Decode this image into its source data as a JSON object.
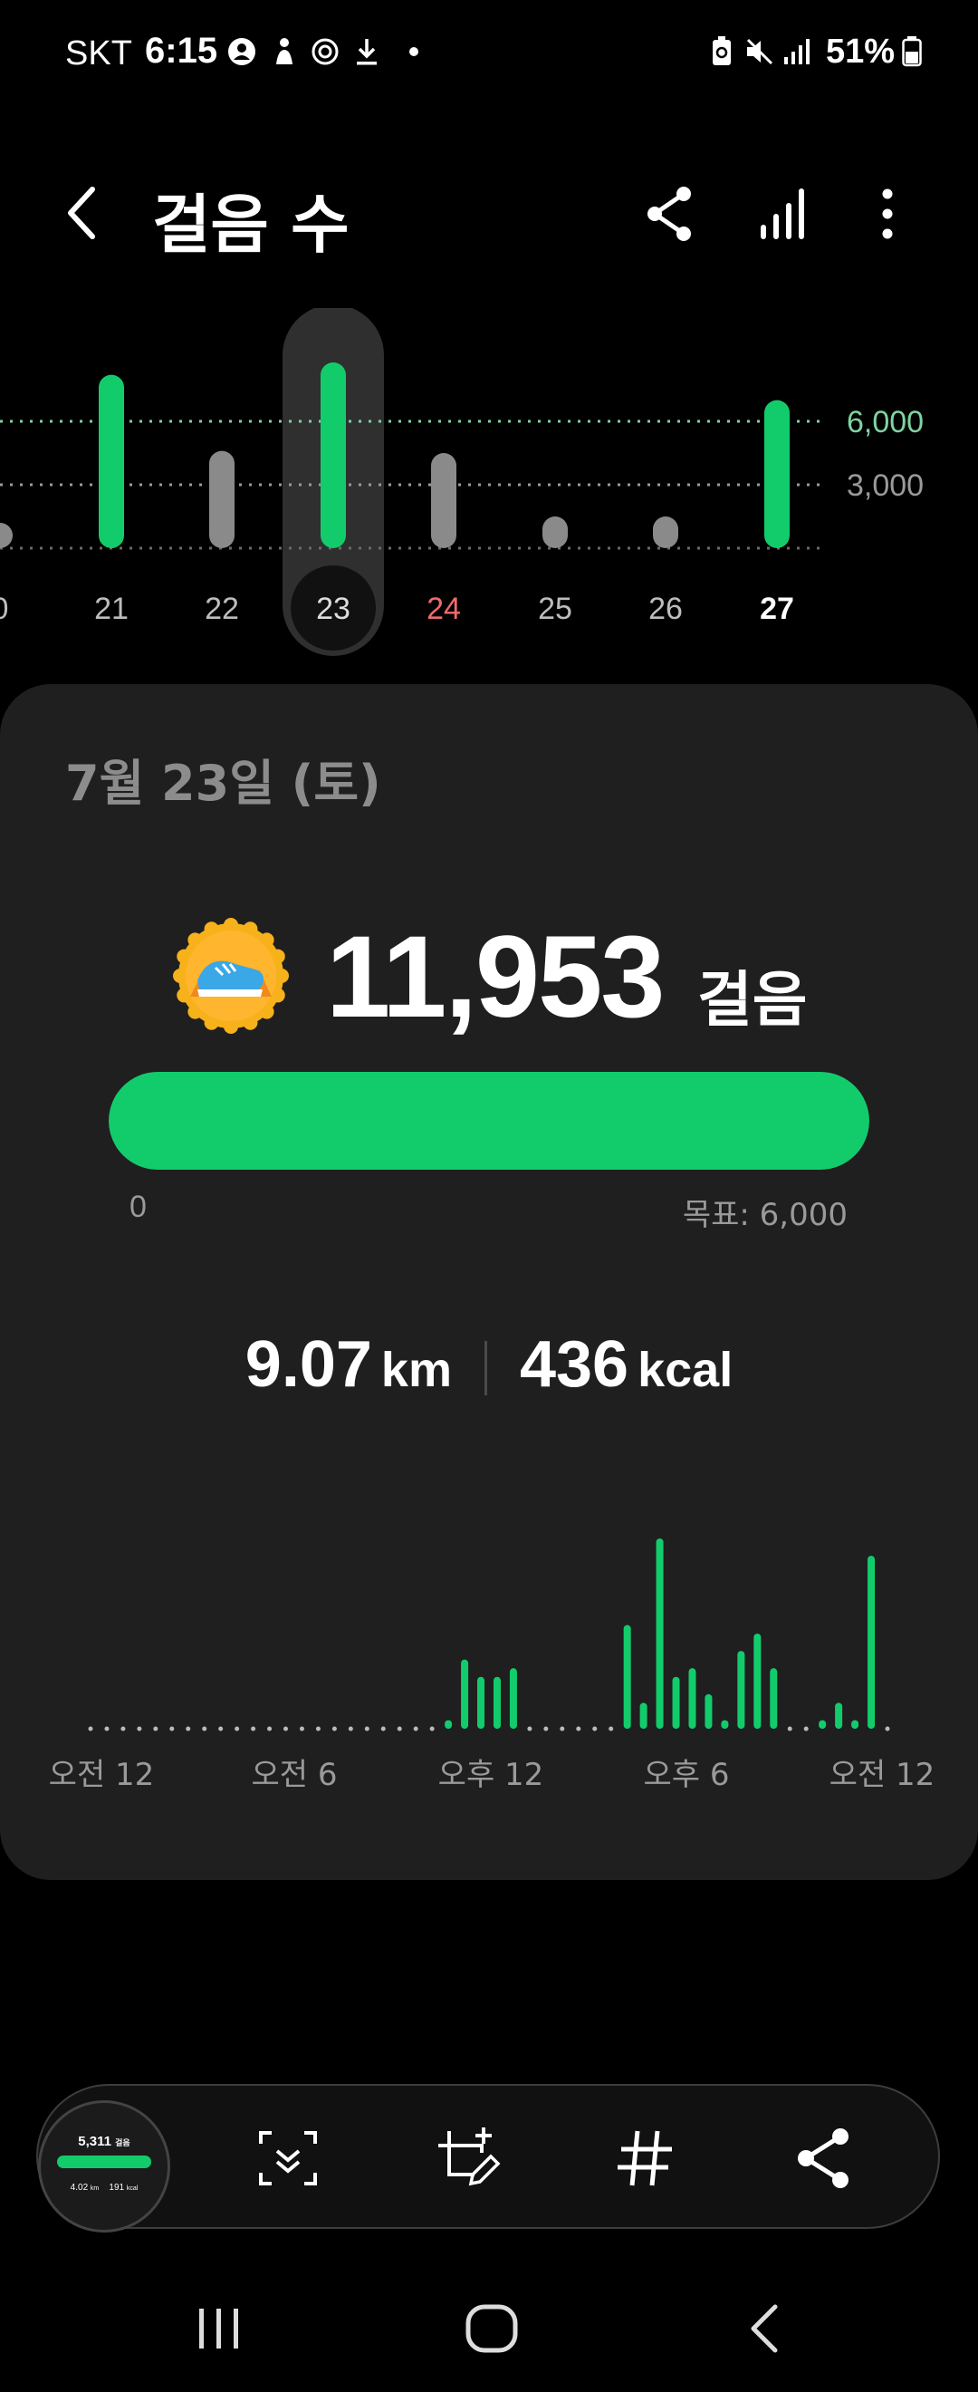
{
  "status_bar": {
    "carrier": "SKT",
    "time": "6:15",
    "battery": "51%"
  },
  "header": {
    "title": "걸음 수"
  },
  "week_chart": {
    "days": [
      {
        "label": "0",
        "value": 300,
        "color": "gray"
      },
      {
        "label": "21",
        "value": 8200,
        "color": "green"
      },
      {
        "label": "22",
        "value": 4600,
        "color": "gray"
      },
      {
        "label": "23",
        "value": 11953,
        "color": "green",
        "selected": true
      },
      {
        "label": "24",
        "value": 4500,
        "color": "gray",
        "weekend": true
      },
      {
        "label": "25",
        "value": 1500,
        "color": "gray"
      },
      {
        "label": "26",
        "value": 1500,
        "color": "gray"
      },
      {
        "label": "27",
        "value": 7000,
        "color": "green",
        "today": true
      }
    ],
    "ref_lines": [
      {
        "label": "6,000",
        "value": 6000,
        "color": "#7fd3a0"
      },
      {
        "label": "3,000",
        "value": 3000,
        "color": "#9a9a9a"
      }
    ],
    "colors": {
      "green": "#12cc6c",
      "gray": "#8a8a8a",
      "weekend": "#ef6b6b"
    }
  },
  "card": {
    "date": "7월 23일 (토)",
    "steps": "11,953",
    "steps_unit": "걸음",
    "progress_min": "0",
    "goal": "목표: 6,000",
    "progress_fraction": 1.0,
    "distance_value": "9.07",
    "distance_unit": "km",
    "calories_value": "436",
    "calories_unit": "kcal"
  },
  "hour_chart": {
    "x_labels": [
      "오전 12",
      "오전 6",
      "오후 12",
      "오후 6",
      "오전 12"
    ],
    "bars": [
      0,
      0,
      0,
      0,
      0,
      0,
      0,
      0,
      0,
      0,
      0,
      0,
      0,
      0,
      0,
      0,
      0,
      0,
      0,
      0,
      0,
      0,
      1,
      8,
      6,
      6,
      7,
      0,
      0,
      0,
      0,
      0,
      0,
      12,
      3,
      22,
      6,
      7,
      4,
      1,
      9,
      11,
      7,
      0,
      0,
      1,
      3,
      1,
      20,
      0
    ]
  },
  "toolbar": {
    "thumb_steps": "5,311",
    "thumb_steps_unit": "걸음",
    "thumb_distance": "4.02",
    "thumb_distance_unit": "km",
    "thumb_calories": "191",
    "thumb_calories_unit": "kcal"
  }
}
